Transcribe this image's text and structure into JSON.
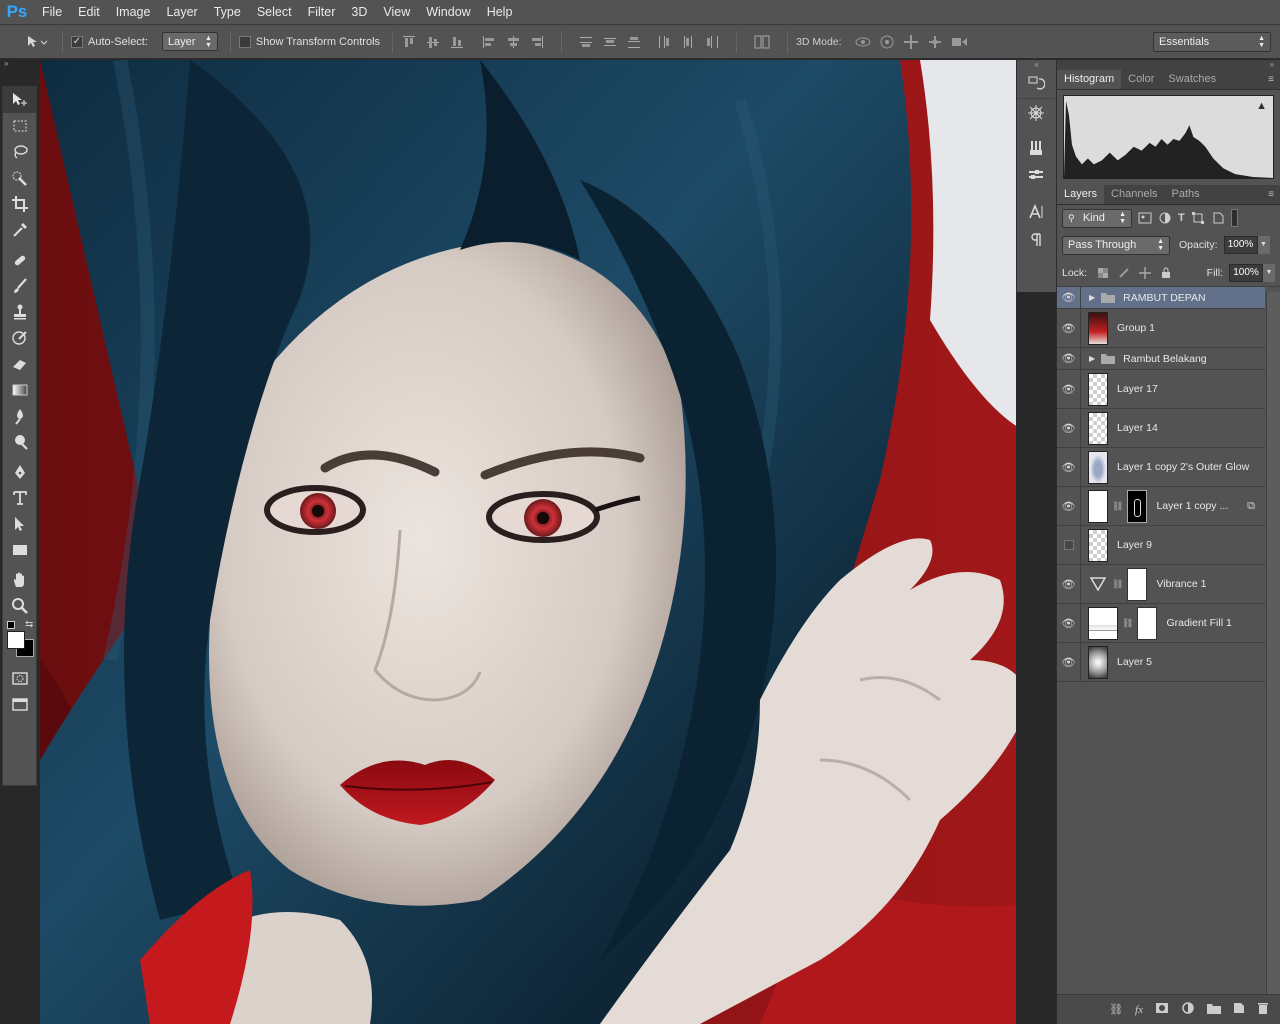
{
  "app": {
    "logo": "Ps"
  },
  "menu": [
    "File",
    "Edit",
    "Image",
    "Layer",
    "Type",
    "Select",
    "Filter",
    "3D",
    "View",
    "Window",
    "Help"
  ],
  "options": {
    "auto_select_label": "Auto-Select:",
    "auto_select_checked": true,
    "auto_select_value": "Layer",
    "show_transform_label": "Show Transform Controls",
    "show_transform_checked": false,
    "mode_3d_label": "3D Mode:",
    "workspace": "Essentials"
  },
  "panels": {
    "top_tabs": [
      "Histogram",
      "Color",
      "Swatches"
    ],
    "layer_tabs": [
      "Layers",
      "Channels",
      "Paths"
    ],
    "filter_kind": "Kind",
    "blend_mode": "Pass Through",
    "opacity_label": "Opacity:",
    "opacity": "100%",
    "lock_label": "Lock:",
    "fill_label": "Fill:",
    "fill": "100%"
  },
  "layers": [
    {
      "name": "RAMBUT DEPAN",
      "type": "folder",
      "visible": true,
      "selected": true
    },
    {
      "name": "Group 1",
      "type": "image",
      "visible": true
    },
    {
      "name": "Rambut Belakang",
      "type": "folder",
      "visible": true
    },
    {
      "name": "Layer 17",
      "type": "layer",
      "visible": true
    },
    {
      "name": "Layer 14",
      "type": "layer",
      "visible": true
    },
    {
      "name": "Layer 1 copy 2's Outer Glow",
      "type": "layer",
      "visible": true
    },
    {
      "name": "Layer 1 copy ...",
      "type": "masked",
      "visible": true
    },
    {
      "name": "Layer 9",
      "type": "layer",
      "visible": false
    },
    {
      "name": "Vibrance 1",
      "type": "adjustment",
      "visible": true
    },
    {
      "name": "Gradient Fill 1",
      "type": "gradient",
      "visible": true
    },
    {
      "name": "Layer 5",
      "type": "cloud",
      "visible": true
    }
  ],
  "colors": {
    "ui": "#535353",
    "dark": "#282828",
    "selection": "#627089",
    "ps_blue": "#31a8ff"
  }
}
